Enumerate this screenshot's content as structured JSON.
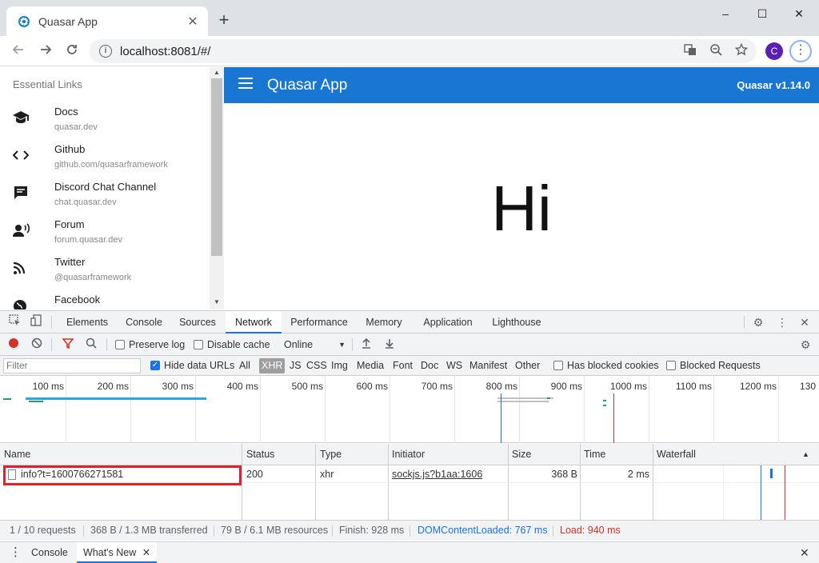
{
  "browser": {
    "tab_title": "Quasar App",
    "tab_close": "✕",
    "new_tab": "+",
    "url": "localhost:8081/#/",
    "avatar_letter": "C",
    "win_min": "–",
    "win_max": "☐",
    "win_close": "✕",
    "menu": "⋮"
  },
  "drawer": {
    "header": "Essential Links",
    "links": [
      {
        "title": "Docs",
        "caption": "quasar.dev",
        "icon": "school-icon"
      },
      {
        "title": "Github",
        "caption": "github.com/quasarframework",
        "icon": "code-icon"
      },
      {
        "title": "Discord Chat Channel",
        "caption": "chat.quasar.dev",
        "icon": "chat-icon"
      },
      {
        "title": "Forum",
        "caption": "forum.quasar.dev",
        "icon": "record-voice-icon"
      },
      {
        "title": "Twitter",
        "caption": "@quasarframework",
        "icon": "rss-icon"
      },
      {
        "title": "Facebook",
        "caption": "",
        "icon": "public-icon"
      }
    ]
  },
  "app": {
    "title": "Quasar App",
    "version": "Quasar v1.14.0",
    "main_text": "Hi",
    "primary_color": "#1976d2"
  },
  "devtools": {
    "tabs": [
      "Elements",
      "Console",
      "Sources",
      "Network",
      "Performance",
      "Memory",
      "Application",
      "Lighthouse"
    ],
    "active_tab": "Network",
    "preserve_log": "Preserve log",
    "disable_cache": "Disable cache",
    "throttle": "Online",
    "filter_placeholder": "Filter",
    "hide_data_urls": "Hide data URLs",
    "types": [
      "All",
      "XHR",
      "JS",
      "CSS",
      "Img",
      "Media",
      "Font",
      "Doc",
      "WS",
      "Manifest",
      "Other"
    ],
    "active_type": "XHR",
    "has_blocked_cookies": "Has blocked cookies",
    "blocked_requests": "Blocked Requests",
    "ticks": [
      "100 ms",
      "200 ms",
      "300 ms",
      "400 ms",
      "500 ms",
      "600 ms",
      "700 ms",
      "800 ms",
      "900 ms",
      "1000 ms",
      "1100 ms",
      "1200 ms",
      "130"
    ],
    "columns": {
      "name": "Name",
      "status": "Status",
      "type": "Type",
      "initiator": "Initiator",
      "size": "Size",
      "time": "Time",
      "waterfall": "Waterfall"
    },
    "rows": [
      {
        "name": "info?t=1600766271581",
        "status": "200",
        "type": "xhr",
        "initiator": "sockjs.js?b1aa:1606",
        "size": "368 B",
        "time": "2 ms"
      }
    ],
    "summary": {
      "requests": "1 / 10 requests",
      "transferred": "368 B / 1.3 MB transferred",
      "resources": "79 B / 6.1 MB resources",
      "finish": "Finish: 928 ms",
      "dcl": "DOMContentLoaded: 767 ms",
      "load": "Load: 940 ms",
      "dcl_color": "#1a73e8",
      "load_color": "#d93025"
    },
    "drawer": {
      "console": "Console",
      "whats_new": "What's New"
    }
  }
}
